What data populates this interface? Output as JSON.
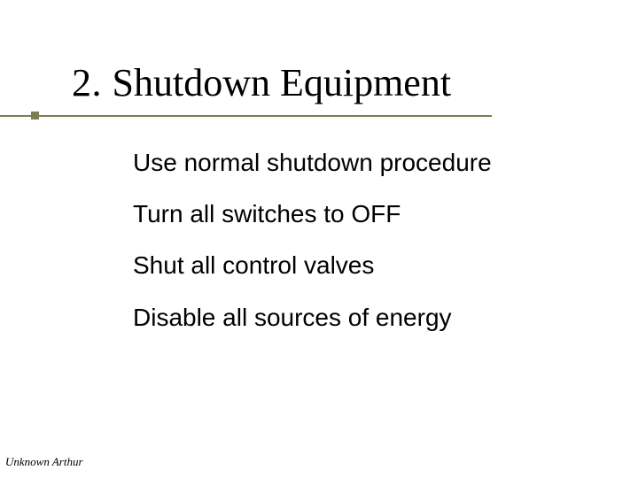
{
  "title": {
    "number": "2. ",
    "text": "Shutdown Equipment"
  },
  "body": {
    "items": [
      "Use normal shutdown procedure",
      "Turn all switches to OFF",
      "Shut all control valves",
      "Disable all sources of energy"
    ]
  },
  "footer": {
    "author": "Unknown Arthur"
  },
  "colors": {
    "accent": "#7b7b54",
    "text": "#000000",
    "background": "#ffffff"
  }
}
